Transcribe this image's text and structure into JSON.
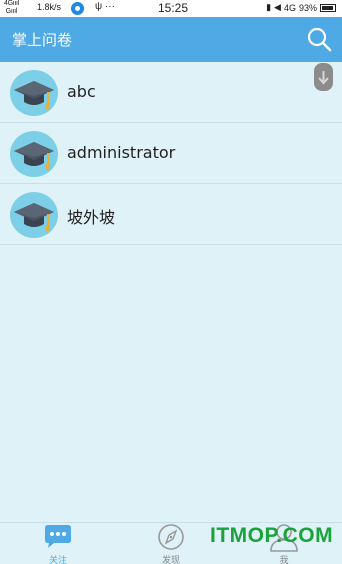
{
  "status_bar": {
    "signal_top": "4G",
    "signal_bottom": "G",
    "speed": "1.8k/s",
    "usb": "ψ ···",
    "time": "15:25",
    "network": "4G",
    "battery": "93%"
  },
  "header": {
    "title": "掌上问卷"
  },
  "list": {
    "items": [
      {
        "label": "abc"
      },
      {
        "label": "administrator"
      },
      {
        "label": "坡外坡"
      }
    ]
  },
  "tabs": [
    {
      "label": "关注",
      "icon": "chat-bubble-icon",
      "active": true
    },
    {
      "label": "发现",
      "icon": "compass-icon",
      "active": false
    },
    {
      "label": "我",
      "icon": "person-icon",
      "active": false
    }
  ],
  "watermark": "ITMOP.COM",
  "colors": {
    "header": "#4fa9e4",
    "background": "#dff2f7",
    "accent": "#4fa9e4",
    "watermark": "#1aa33a"
  }
}
